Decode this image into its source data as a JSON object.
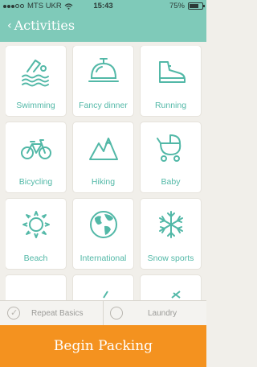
{
  "status": {
    "carrier": "MTS UKR",
    "time": "15:43",
    "battery": "75%",
    "battery_level": 0.75
  },
  "nav": {
    "back_label": "Activities"
  },
  "tiles": [
    {
      "label": "Swimming",
      "icon": "swimming-icon"
    },
    {
      "label": "Fancy dinner",
      "icon": "cloche-icon"
    },
    {
      "label": "Running",
      "icon": "shoe-icon"
    },
    {
      "label": "Bicycling",
      "icon": "bicycle-icon"
    },
    {
      "label": "Hiking",
      "icon": "mountain-icon"
    },
    {
      "label": "Baby",
      "icon": "stroller-icon"
    },
    {
      "label": "Beach",
      "icon": "sun-icon"
    },
    {
      "label": "International",
      "icon": "globe-icon"
    },
    {
      "label": "Snow sports",
      "icon": "snowflake-icon"
    }
  ],
  "options": {
    "repeat_basics": {
      "label": "Repeat Basics",
      "checked": true
    },
    "laundry": {
      "label": "Laundry",
      "checked": false
    }
  },
  "cta": {
    "label": "Begin Packing"
  },
  "colors": {
    "accent": "#7fcab9",
    "icon": "#52b8a7",
    "button": "#f4921f"
  }
}
